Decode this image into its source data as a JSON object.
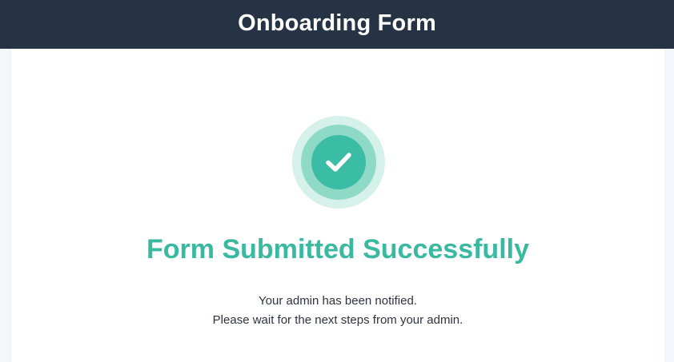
{
  "header": {
    "title": "Onboarding Form"
  },
  "result": {
    "icon": "check-circle-icon",
    "title": "Form Submitted Successfully",
    "message_line1": "Your admin has been notified.",
    "message_line2": "Please wait for the next steps from your admin."
  },
  "colors": {
    "header_bg": "#263345",
    "success": "#3ab9a1",
    "ring_light": "#d6f1ea",
    "ring_mid": "#8fd9c7",
    "page_bg": "#f3f6fa"
  }
}
